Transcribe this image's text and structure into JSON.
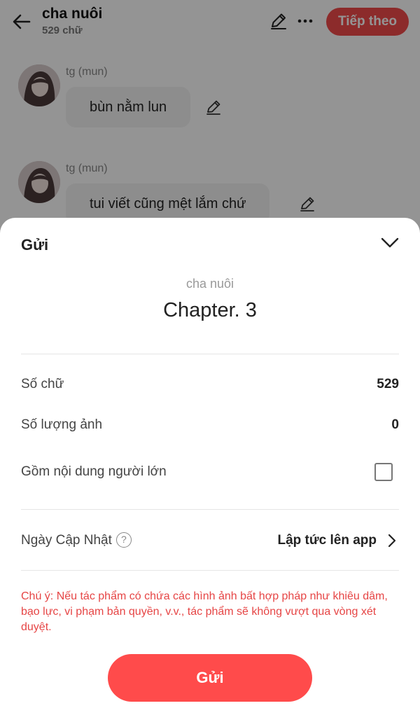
{
  "header": {
    "title": "cha nuôi",
    "word_count": "529 chữ",
    "next_label": "Tiếp theo"
  },
  "messages": [
    {
      "author": "tg (mun)",
      "text": "bùn nằm lun"
    },
    {
      "author": "tg (mun)",
      "text": "tui viết cũng mệt lắm chứ"
    }
  ],
  "sheet": {
    "title": "Gửi",
    "story_title": "cha nuôi",
    "chapter": "Chapter. 3",
    "stats": {
      "words_label": "Số chữ",
      "words_value": "529",
      "images_label": "Số lượng ảnh",
      "images_value": "0"
    },
    "adult": {
      "label": "Gồm nội dung người lớn",
      "checked": false
    },
    "schedule": {
      "label": "Ngày Cập Nhật",
      "help_glyph": "?",
      "value": "Lập tức lên app"
    },
    "notice": "Chú ý: Nếu tác phẩm có chứa các hình ảnh bất hợp pháp như khiêu dâm, bạo lực, vi phạm bản quyền, v.v., tác phẩm sẽ không vượt qua vòng xét duyệt.",
    "send_label": "Gửi"
  },
  "icons": {
    "back": "arrow-left-icon",
    "edit": "pencil-icon",
    "more": "more-horizontal-icon",
    "collapse": "chevron-down-icon",
    "open": "chevron-right-icon",
    "help": "help-circle-icon"
  },
  "colors": {
    "accent": "#ff4b4b",
    "notice": "#e64545"
  }
}
